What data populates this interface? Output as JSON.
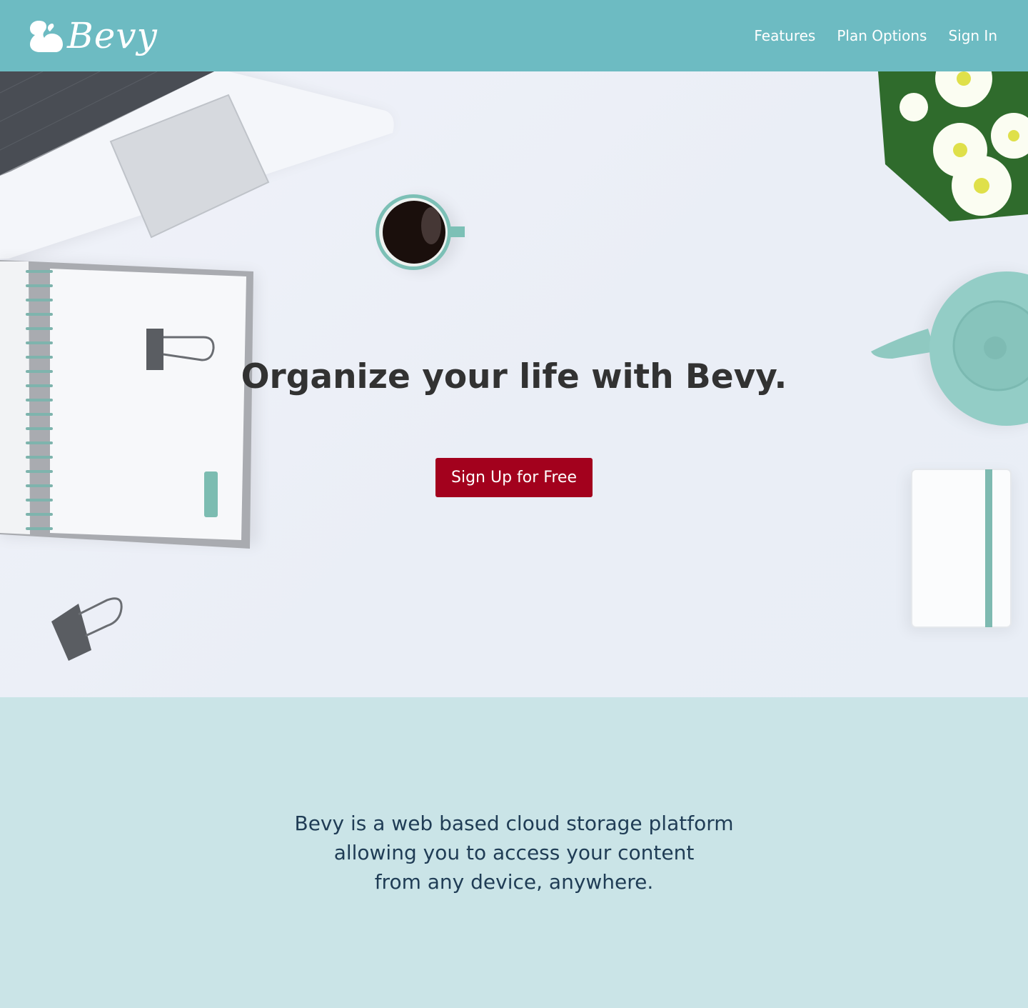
{
  "header": {
    "brand": "Bevy",
    "nav": [
      {
        "label": "Features"
      },
      {
        "label": "Plan Options"
      },
      {
        "label": "Sign In"
      }
    ]
  },
  "hero": {
    "title": "Organize your life with Bevy.",
    "cta_label": "Sign Up for Free"
  },
  "about": {
    "lines": [
      "Bevy is a web based cloud storage platform",
      "allowing you to access your content",
      "from any device, anywhere."
    ]
  },
  "colors": {
    "header_bg": "#6dbbc2",
    "cta_bg": "#a3011d",
    "about_bg": "#cae4e7",
    "about_text": "#1f3c55",
    "title_text": "#323232"
  },
  "icons": {
    "logo": "squirrel-logo-icon"
  }
}
